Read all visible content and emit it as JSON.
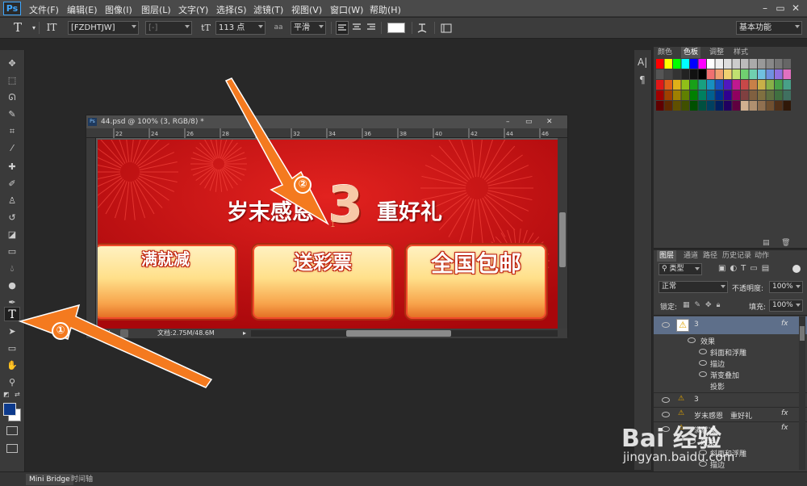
{
  "app": {
    "logo": "Ps"
  },
  "menu": {
    "items": [
      "文件(F)",
      "编辑(E)",
      "图像(I)",
      "图层(L)",
      "文字(Y)",
      "选择(S)",
      "滤镜(T)",
      "视图(V)",
      "窗口(W)",
      "帮助(H)"
    ]
  },
  "window_controls": {
    "minimize": "–",
    "restore": "▭",
    "close": "✕"
  },
  "options_bar": {
    "tool_icon": "T",
    "orient_icon": "IT",
    "font_family": "[FZDHTJW]",
    "font_style": "[-]",
    "size_icon": "tT",
    "font_size": "113 点",
    "aa_icon": "aa",
    "antialias": "平滑",
    "workspace": "基本功能"
  },
  "tools": [
    "move-tool",
    "marquee-tool",
    "lasso-tool",
    "quick-select-tool",
    "crop-tool",
    "eyedropper-tool",
    "spot-heal-tool",
    "brush-tool",
    "stamp-tool",
    "history-brush-tool",
    "eraser-tool",
    "gradient-tool",
    "blur-tool",
    "dodge-tool",
    "pen-tool",
    "type-tool",
    "path-select-tool",
    "shape-tool",
    "hand-tool",
    "zoom-tool"
  ],
  "document": {
    "title": "44.psd @ 100% (3, RGB/8) *",
    "ruler_marks": [
      "22",
      "24",
      "26",
      "28",
      "30",
      "32",
      "34",
      "36",
      "38",
      "40",
      "42",
      "44",
      "46"
    ],
    "zoom": "100%",
    "doc_info": "文档:2.75M/48.6M",
    "banner": {
      "headline_left": "岁末感恩",
      "headline_number": "3",
      "headline_right": "重好礼",
      "buttons": [
        "满就减",
        "送彩票",
        "全国包邮"
      ]
    }
  },
  "swatches_panel": {
    "tabs": [
      "颜色",
      "色板",
      "调整",
      "样式"
    ],
    "active_tab": "色板"
  },
  "layers_panel": {
    "tabs": [
      "图层",
      "通道",
      "路径",
      "历史记录",
      "动作"
    ],
    "filter": "类型",
    "blend_mode": "正常",
    "opacity_label": "不透明度:",
    "opacity": "100%",
    "lock_label": "锁定:",
    "fill_label": "填充:",
    "fill": "100%",
    "layers": [
      {
        "name": "3",
        "selected": true,
        "fx": "fx"
      },
      {
        "name": "效果",
        "indent": 1
      },
      {
        "name": "斜面和浮雕",
        "indent": 2
      },
      {
        "name": "描边",
        "indent": 2
      },
      {
        "name": "渐变叠加",
        "indent": 2
      },
      {
        "name": "投影",
        "indent": 2
      },
      {
        "name": "3",
        "indent": 0
      },
      {
        "name": "岁末感恩　重好礼",
        "indent": 0,
        "fx": "fx"
      },
      {
        "name": "满就减",
        "indent": 0,
        "fx": "fx"
      },
      {
        "name": "效果",
        "indent": 1
      },
      {
        "name": "斜面和浮雕",
        "indent": 2
      },
      {
        "name": "描边",
        "indent": 2
      }
    ]
  },
  "annotations": {
    "marker1": "①",
    "marker2": "②"
  },
  "bottom_tabs": [
    "Mini Bridge",
    "时间轴"
  ],
  "watermark": {
    "line1": "Bai 经验",
    "line2": "jingyan.baidu.com"
  },
  "colors": {
    "accent_arrow": "#f47a1f",
    "banner_red": "#c80e0f",
    "foreground": "#0d3a8c",
    "background": "#ffffff"
  }
}
